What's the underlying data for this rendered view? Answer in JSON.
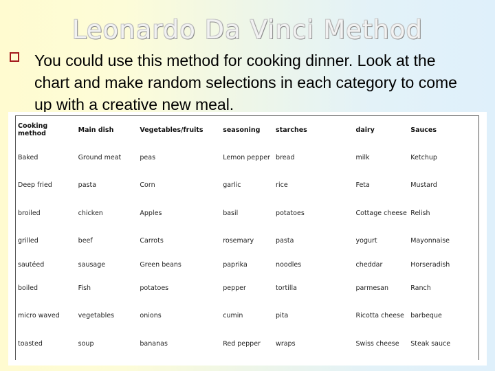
{
  "slide": {
    "title": "Leonardo Da Vinci Method",
    "bullet_icon": "hollow-square-bullet",
    "bullet_color": "#a3191c",
    "bullet_text": "You could use this method for cooking dinner. Look at the chart and make random selections in each category to come up with a creative new meal."
  },
  "table": {
    "headers": [
      "Cooking method",
      "Main dish",
      "Vegetables/fruits",
      "seasoning",
      "starches",
      "dairy",
      "Sauces"
    ],
    "rows": [
      [
        "Baked",
        "Ground meat",
        "peas",
        "Lemon pepper",
        "bread",
        "milk",
        "Ketchup"
      ],
      [
        "Deep fried",
        "pasta",
        "Corn",
        "garlic",
        "rice",
        "Feta",
        "Mustard"
      ],
      [
        "broiled",
        "chicken",
        "Apples",
        "basil",
        "potatoes",
        "Cottage cheese",
        "Relish"
      ],
      [
        "grilled",
        "beef",
        "Carrots",
        "rosemary",
        "pasta",
        "yogurt",
        "Mayonnaise"
      ],
      [
        "sautéed",
        "sausage",
        "Green beans",
        "paprika",
        "noodles",
        "cheddar",
        "Horseradish"
      ],
      [
        "boiled",
        "Fish",
        "potatoes",
        "pepper",
        "tortilla",
        "parmesan",
        "Ranch"
      ],
      [
        "micro waved",
        "vegetables",
        "onions",
        "cumin",
        "pita",
        "Ricotta cheese",
        "barbeque"
      ],
      [
        "toasted",
        "soup",
        "bananas",
        "Red pepper",
        "wraps",
        "Swiss cheese",
        "Steak sauce"
      ]
    ]
  }
}
